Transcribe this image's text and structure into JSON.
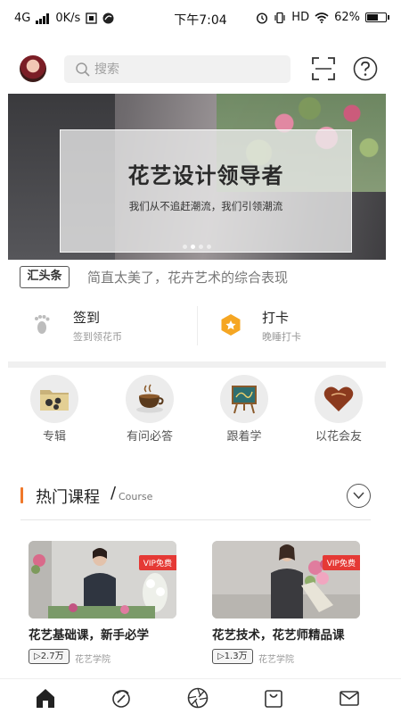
{
  "status_bar": {
    "network": "4G",
    "speed": "0K/s",
    "time": "下午7:04",
    "hd": "HD",
    "battery": "62%",
    "battery_level": 0.62
  },
  "header": {
    "search_placeholder": "搜索",
    "avatar_icon": "user-avatar",
    "scan_icon": "scan-icon",
    "help_icon": "question-icon"
  },
  "banner": {
    "title": "花艺设计领导者",
    "subtitle": "我们从不追赶潮流，我们引领潮流",
    "slide_count": 4,
    "active_slide": 1
  },
  "ticker": {
    "badge": "汇头条",
    "text": "简直太美了，花卉艺术的综合表现"
  },
  "checkin": [
    {
      "label": "签到",
      "sub": "签到领花币",
      "icon": "footprint-icon"
    },
    {
      "label": "打卡",
      "sub": "晚睡打卡",
      "icon": "hexagon-badge-icon",
      "accent": "#f5a623"
    }
  ],
  "categories": [
    {
      "label": "专辑",
      "icon": "album-folder-icon"
    },
    {
      "label": "有问必答",
      "icon": "coffee-cup-icon"
    },
    {
      "label": "跟着学",
      "icon": "easel-board-icon"
    },
    {
      "label": "以花会友",
      "icon": "heart-gift-icon"
    }
  ],
  "section": {
    "title": "热门课程",
    "slash": "/",
    "subtitle": "Course",
    "accent": "#f0782a"
  },
  "courses": [
    {
      "name": "花艺基础课，新手必学",
      "badge": "VIP免费",
      "plays": "▷2.7万",
      "source": "花艺学院"
    },
    {
      "name": "花艺技术，花艺师精品课",
      "badge": "VIP免费",
      "plays": "▷1.3万",
      "source": "花艺学院"
    }
  ],
  "tabbar": [
    {
      "icon": "home-icon",
      "active": true
    },
    {
      "icon": "discover-icon",
      "active": false
    },
    {
      "icon": "aperture-icon",
      "active": false
    },
    {
      "icon": "shopping-bag-icon",
      "active": false
    },
    {
      "icon": "mail-icon",
      "active": false
    }
  ]
}
